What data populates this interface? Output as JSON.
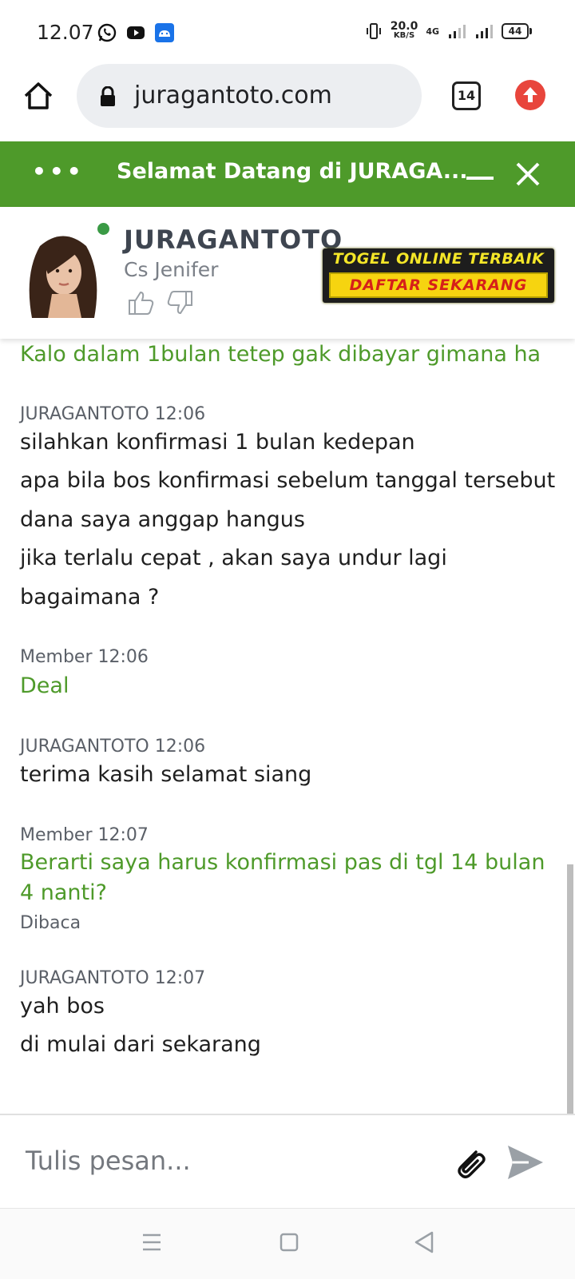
{
  "status_bar": {
    "time": "12.07",
    "net_speed": "20.0",
    "net_unit": "KB/S",
    "network": "4G",
    "battery": "44"
  },
  "browser": {
    "url": "juragantoto.com",
    "tab_count": "14"
  },
  "chat_header": {
    "title": "Selamat Datang di JURAGA..."
  },
  "agent": {
    "name": "JURAGANTOTO",
    "role": "Cs Jenifer",
    "status_color": "#3a9a45"
  },
  "banner": {
    "top_text": "TOGEL ONLINE TERBAIK",
    "bottom_text": "DAFTAR SEKARANG"
  },
  "messages": {
    "partial_member": "Kalo dalam 1bulan tetep gak dibayar gimana ha",
    "m1_meta": "JURAGANTOTO 12:06",
    "m1_lines": [
      "silahkan konfirmasi 1 bulan kedepan",
      "apa bila bos konfirmasi sebelum tanggal tersebut",
      "dana saya anggap hangus",
      "jika terlalu cepat , akan saya undur lagi",
      "bagaimana ?"
    ],
    "m2_meta": "Member 12:06",
    "m2_text": "Deal",
    "m3_meta": "JURAGANTOTO 12:06",
    "m3_text": "terima kasih selamat siang",
    "m4_meta": "Member 12:07",
    "m4_text": "Berarti saya harus konfirmasi pas di tgl 14 bulan 4 nanti?",
    "m4_status": "Dibaca",
    "m5_meta": "JURAGANTOTO 12:07",
    "m5_lines": [
      "yah bos",
      "di mulai dari sekarang"
    ]
  },
  "composer": {
    "placeholder": "Tulis pesan..."
  },
  "colors": {
    "brand_green": "#4e9a2a",
    "update_red": "#e8453c"
  }
}
